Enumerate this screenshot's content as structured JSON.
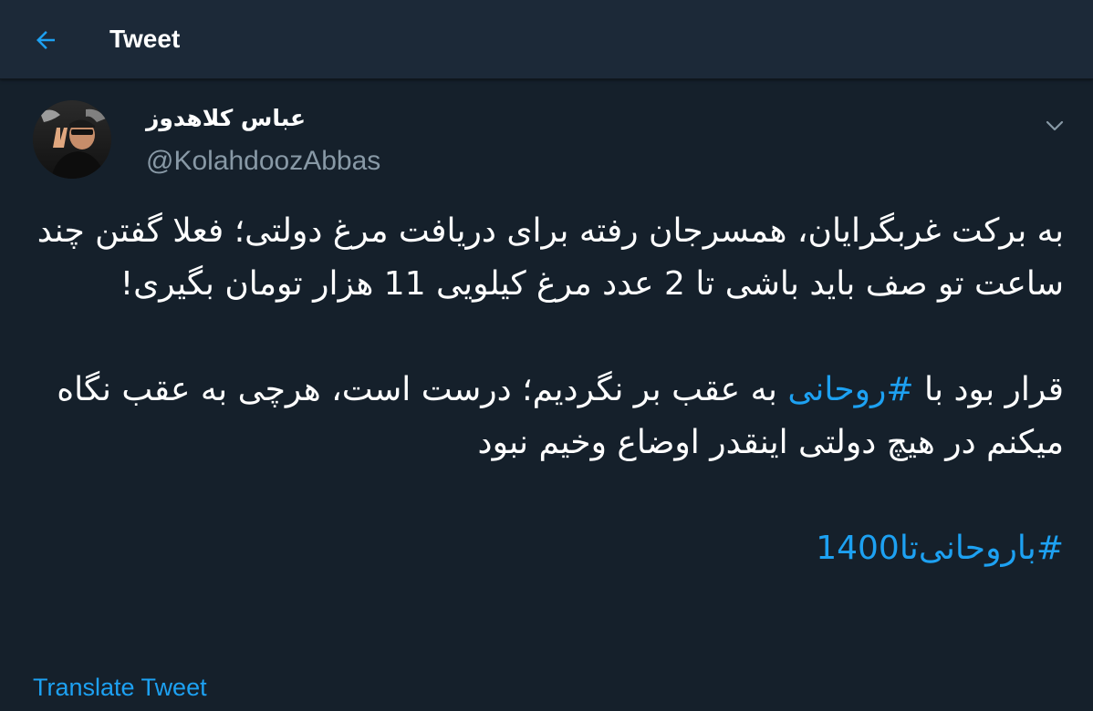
{
  "header": {
    "title": "Tweet",
    "back_icon": "arrow-left-icon"
  },
  "colors": {
    "background": "#15202b",
    "header_bg": "#1c2938",
    "accent": "#1da1f2",
    "secondary_text": "#8899a6"
  },
  "tweet": {
    "author": {
      "display_name": "عباس کلاهدوز",
      "handle": "@KolahdoozAbbas"
    },
    "caret_icon": "chevron-down-icon",
    "paragraph1": "به برکت غربگرایان، همسرجان رفته برای دریافت مرغ دولتی؛ فعلا گفتن چند ساعت تو صف باید باشی تا 2 عدد مرغ کیلویی 11 هزار تومان بگیری!",
    "paragraph2": {
      "before": "قرار بود با ",
      "hashtag": "#روحانی",
      "after": " به عقب بر نگردیم؛ درست است، هرچی به عقب نگاه میکنم در هیچ دولتی اینقدر اوضاع وخیم نبود"
    },
    "hashtag_line": "#باروحانی‌تا1400",
    "translate_label": "Translate Tweet"
  }
}
